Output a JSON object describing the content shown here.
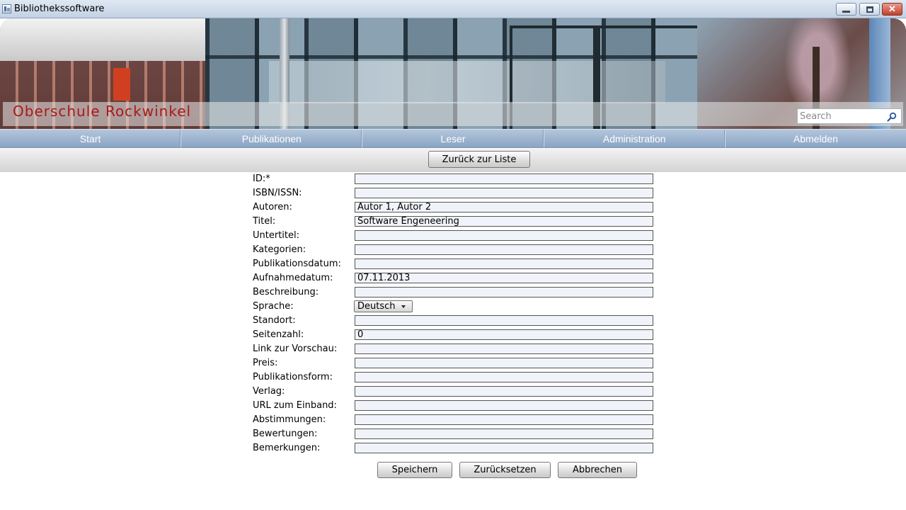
{
  "window": {
    "title": "Bibliothekssoftware"
  },
  "banner": {
    "school_name": "Oberschule Rockwinkel",
    "search_placeholder": "Search"
  },
  "nav": {
    "items": [
      {
        "label": "Start"
      },
      {
        "label": "Publikationen"
      },
      {
        "label": "Leser"
      },
      {
        "label": "Administration"
      },
      {
        "label": "Abmelden"
      }
    ]
  },
  "subbar": {
    "back_label": "Zurück zur Liste"
  },
  "form": {
    "fields": [
      {
        "label": "ID:*",
        "value": ""
      },
      {
        "label": "ISBN/ISSN:",
        "value": ""
      },
      {
        "label": "Autoren:",
        "value": "Autor 1, Autor 2"
      },
      {
        "label": "Titel:",
        "value": "Software Engeneering"
      },
      {
        "label": "Untertitel:",
        "value": ""
      },
      {
        "label": "Kategorien:",
        "value": ""
      },
      {
        "label": "Publikationsdatum:",
        "value": ""
      },
      {
        "label": "Aufnahmedatum:",
        "value": "07.11.2013"
      },
      {
        "label": "Beschreibung:",
        "value": ""
      },
      {
        "label": "Sprache:",
        "value": "Deutsch"
      },
      {
        "label": "Standort:",
        "value": ""
      },
      {
        "label": "Seitenzahl:",
        "value": "0"
      },
      {
        "label": "Link zur Vorschau:",
        "value": ""
      },
      {
        "label": "Preis:",
        "value": ""
      },
      {
        "label": "Publikationsform:",
        "value": ""
      },
      {
        "label": "Verlag:",
        "value": ""
      },
      {
        "label": "URL zum Einband:",
        "value": ""
      },
      {
        "label": "Abstimmungen:",
        "value": ""
      },
      {
        "label": "Bewertungen:",
        "value": ""
      },
      {
        "label": "Bemerkungen:",
        "value": ""
      }
    ],
    "save_label": "Speichern",
    "reset_label": "Zurücksetzen",
    "cancel_label": "Abbrechen"
  }
}
